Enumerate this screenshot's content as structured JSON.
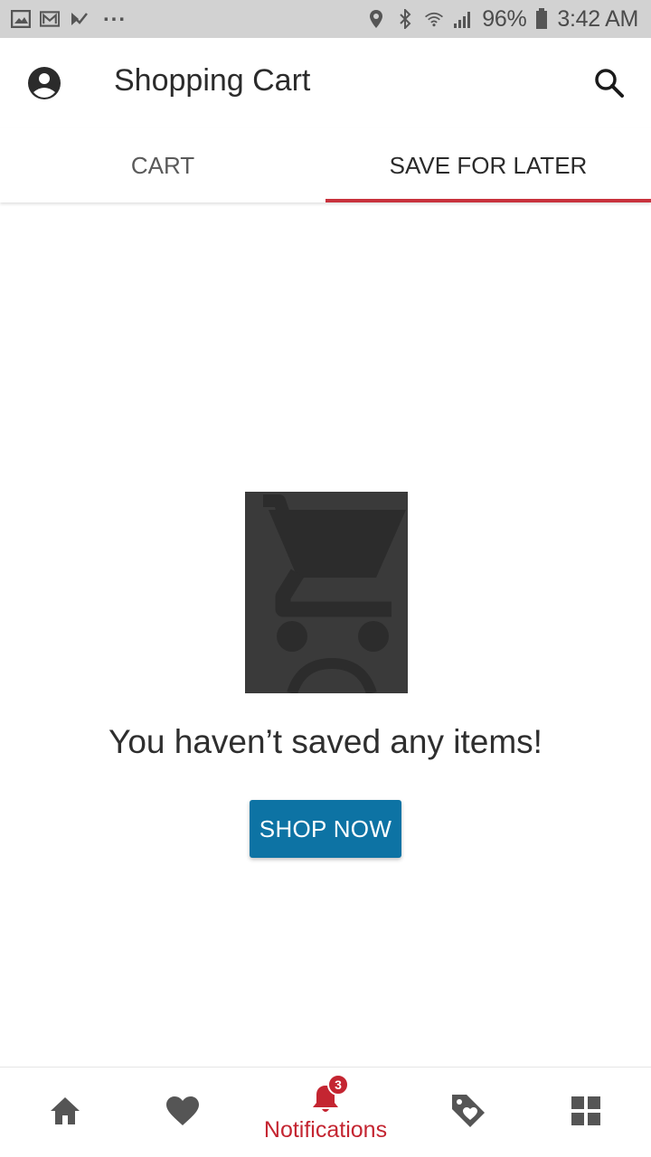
{
  "status_bar": {
    "battery": "96%",
    "time": "3:42 AM",
    "icons_left": [
      "gallery-icon",
      "gmail-icon",
      "check-icon",
      "more-dots-icon"
    ],
    "icons_right": [
      "location-icon",
      "bluetooth-icon",
      "wifi-icon",
      "signal-icon",
      "battery-icon"
    ]
  },
  "app_bar": {
    "title": "Shopping Cart",
    "left_icon": "account-circle-icon",
    "right_icon": "search-icon"
  },
  "tabs": [
    {
      "label": "CART",
      "active": false
    },
    {
      "label": "SAVE FOR LATER",
      "active": true
    }
  ],
  "empty_state": {
    "image": "sad-cart-icon",
    "message": "You haven’t saved any items!",
    "button_label": "SHOP NOW"
  },
  "bottom_nav": {
    "items": [
      {
        "icon": "home-icon",
        "label": ""
      },
      {
        "icon": "heart-icon",
        "label": ""
      },
      {
        "icon": "bell-icon",
        "label": "Notifications",
        "badge": "3"
      },
      {
        "icon": "tag-heart-icon",
        "label": ""
      },
      {
        "icon": "grid-icon",
        "label": ""
      }
    ]
  },
  "colors": {
    "accent": "#c8323d",
    "button": "#0d73a4",
    "status_bar": "#d2d2d2",
    "icon_gray": "#555555"
  }
}
